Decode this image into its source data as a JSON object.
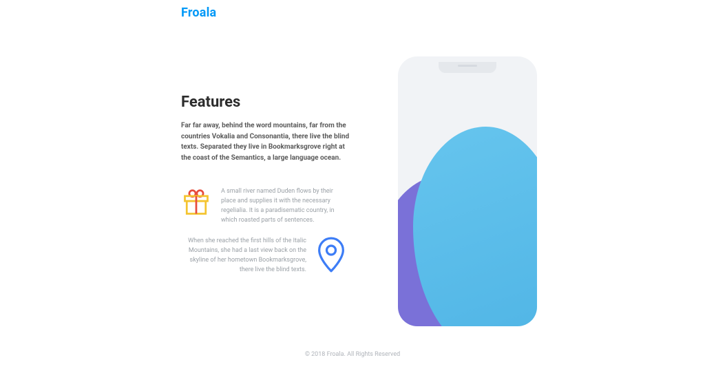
{
  "brand": {
    "name": "Froala"
  },
  "main": {
    "heading": "Features",
    "lead": "Far far away, behind the word mountains, far from the countries Vokalia and Consonantia, there live the blind texts. Separated they live in Bookmarksgrove right at the coast of the Semantics, a large language ocean."
  },
  "features": [
    {
      "icon": "gift",
      "text": "A small river named Duden flows by their place and supplies it with the necessary regelialia. It is a paradisematic country, in which roasted parts of sentences."
    },
    {
      "icon": "location-pin",
      "text": "When she reached the first hills of the Italic Mountains, she had a last view back on the skyline of her hometown Bookmarksgrove, there live the blind texts."
    }
  ],
  "footer": {
    "copyright": "© 2018 Froala. All Rights Reserved"
  }
}
